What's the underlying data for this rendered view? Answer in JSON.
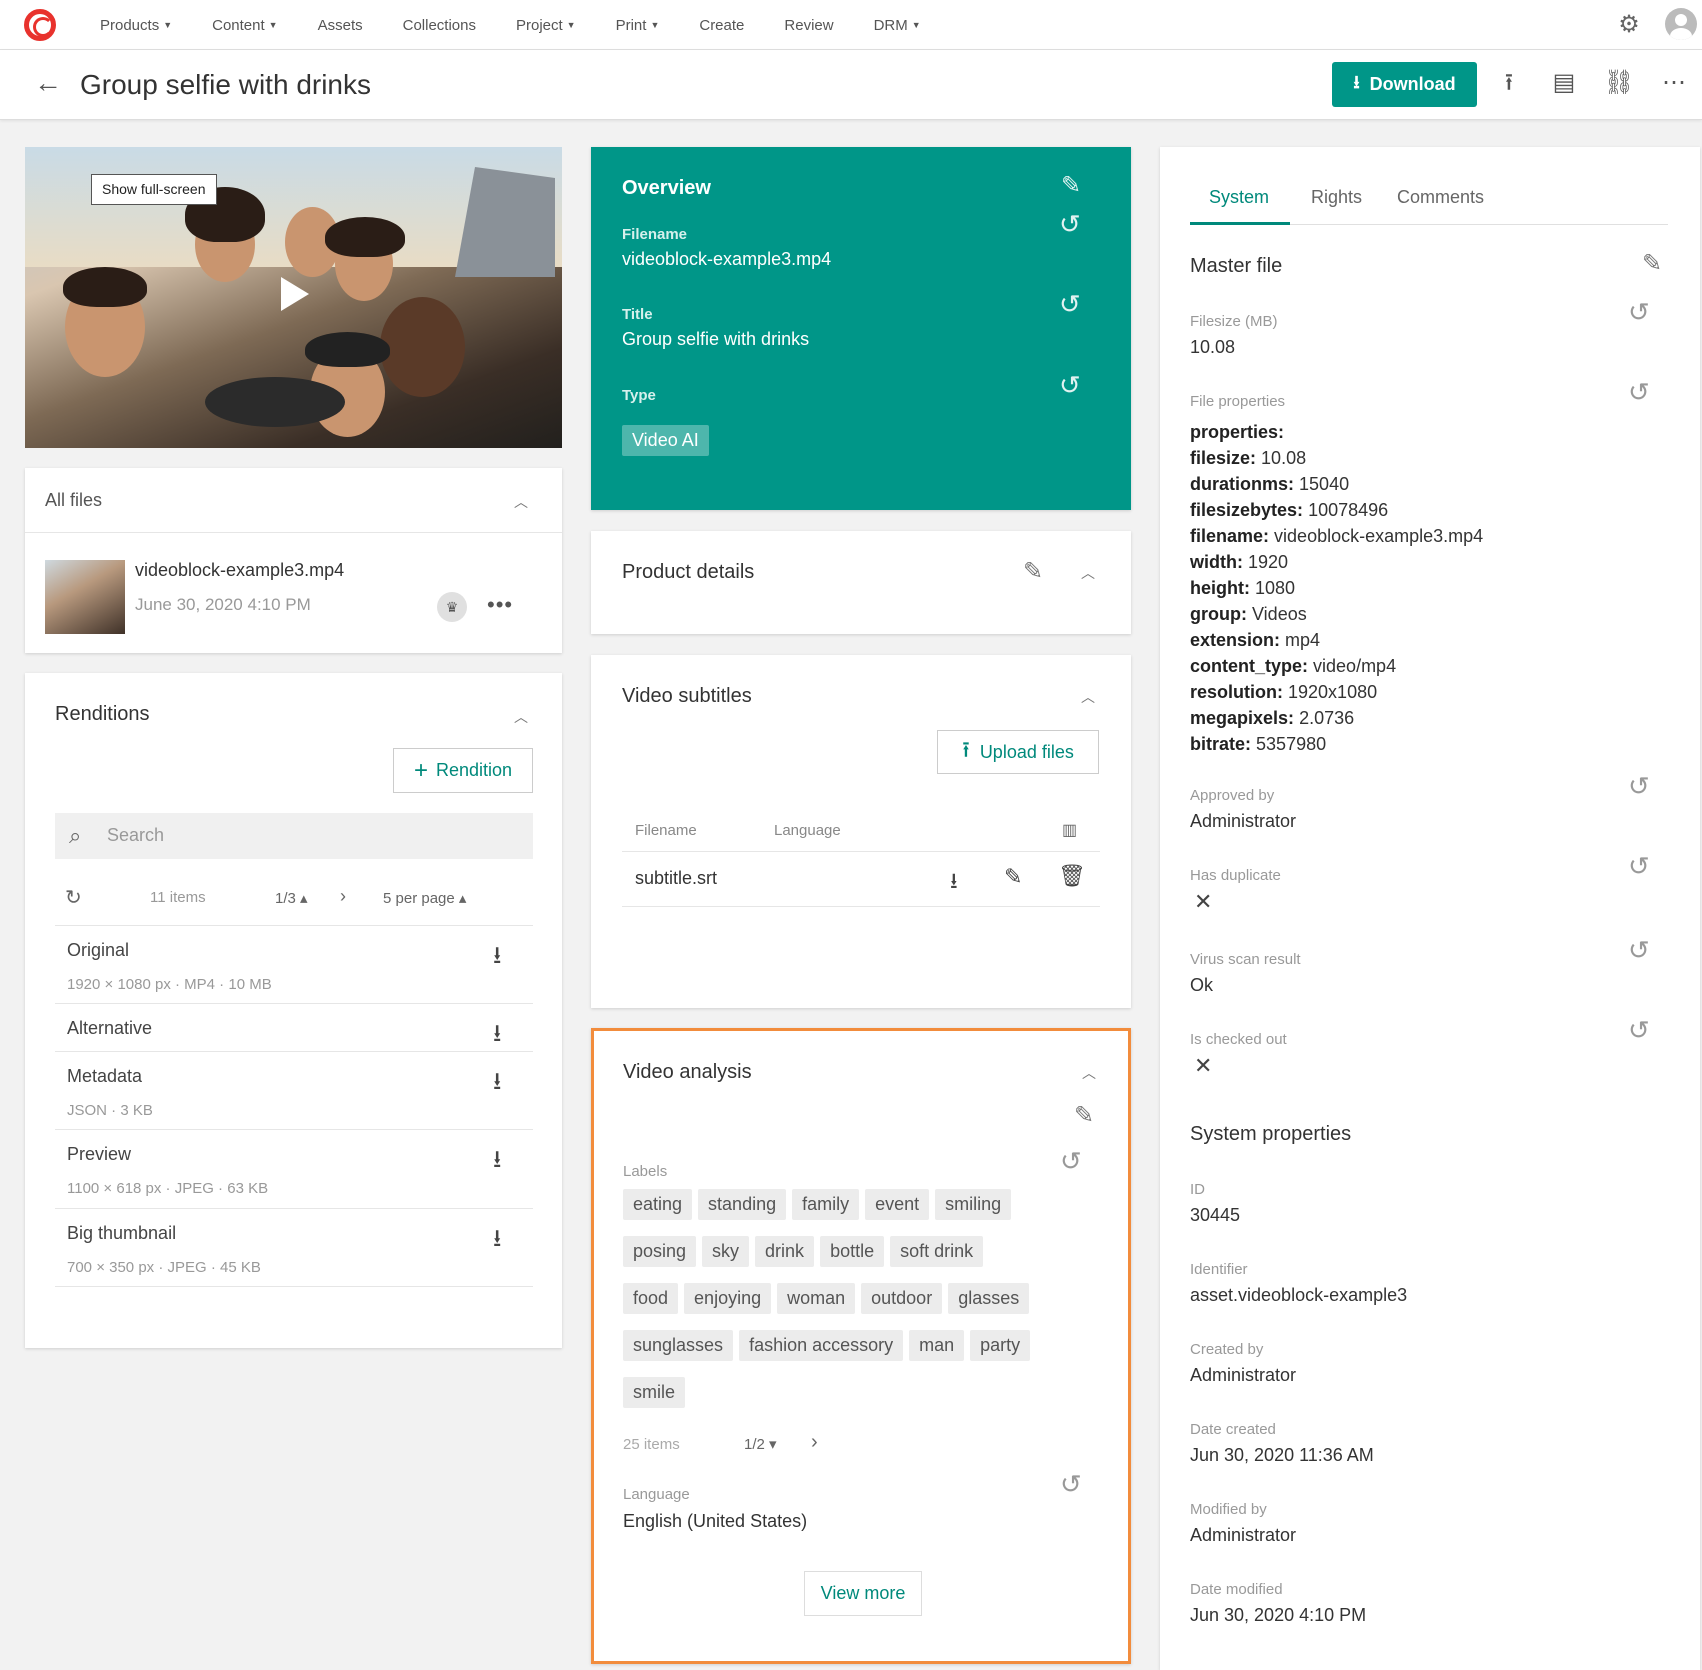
{
  "nav": {
    "items": [
      {
        "label": "Products",
        "caret": true
      },
      {
        "label": "Content",
        "caret": true
      },
      {
        "label": "Assets",
        "caret": false
      },
      {
        "label": "Collections",
        "caret": false
      },
      {
        "label": "Project",
        "caret": true
      },
      {
        "label": "Print",
        "caret": true
      },
      {
        "label": "Create",
        "caret": false
      },
      {
        "label": "Review",
        "caret": false
      },
      {
        "label": "DRM",
        "caret": true
      }
    ]
  },
  "header": {
    "title": "Group selfie with drinks",
    "download_label": "Download"
  },
  "preview": {
    "fullscreen_label": "Show full-screen"
  },
  "all_files": {
    "title": "All files",
    "file": {
      "name": "videoblock-example3.mp4",
      "date": "June 30, 2020 4:10 PM"
    }
  },
  "renditions": {
    "title": "Renditions",
    "add_label": "Rendition",
    "search_placeholder": "Search",
    "count": "11 items",
    "page": "1/3",
    "per_page": "5 per page",
    "rows": [
      {
        "name": "Original",
        "meta": "1920 × 1080 px · MP4 · 10 MB"
      },
      {
        "name": "Alternative",
        "meta": ""
      },
      {
        "name": "Metadata",
        "meta": "JSON · 3 KB"
      },
      {
        "name": "Preview",
        "meta": "1100 × 618 px · JPEG · 63 KB"
      },
      {
        "name": "Big thumbnail",
        "meta": "700 × 350 px · JPEG · 45 KB"
      }
    ]
  },
  "overview": {
    "title": "Overview",
    "filename_label": "Filename",
    "filename": "videoblock-example3.mp4",
    "title_label": "Title",
    "title_value": "Group selfie with drinks",
    "type_label": "Type",
    "type_value": "Video AI"
  },
  "product_details": {
    "title": "Product details"
  },
  "video_subtitles": {
    "title": "Video subtitles",
    "upload_label": "Upload files",
    "col_filename": "Filename",
    "col_language": "Language",
    "rows": [
      {
        "filename": "subtitle.srt"
      }
    ]
  },
  "video_analysis": {
    "title": "Video analysis",
    "labels_label": "Labels",
    "labels": [
      "eating",
      "standing",
      "family",
      "event",
      "smiling",
      "posing",
      "sky",
      "drink",
      "bottle",
      "soft drink",
      "food",
      "enjoying",
      "woman",
      "outdoor",
      "glasses",
      "sunglasses",
      "fashion accessory",
      "man",
      "party",
      "smile"
    ],
    "count": "25 items",
    "page": "1/2",
    "language_label": "Language",
    "language": "English (United States)",
    "view_more_label": "View more"
  },
  "system": {
    "tabs": [
      "System",
      "Rights",
      "Comments"
    ],
    "master_file_title": "Master file",
    "filesize_label": "Filesize (MB)",
    "filesize": "10.08",
    "file_properties_label": "File properties",
    "properties_header": "properties:",
    "properties": [
      {
        "k": "filesize:",
        "v": "10.08"
      },
      {
        "k": "durationms:",
        "v": "15040"
      },
      {
        "k": "filesizebytes:",
        "v": "10078496"
      },
      {
        "k": "filename:",
        "v": "videoblock-example3.mp4"
      },
      {
        "k": "width:",
        "v": "1920"
      },
      {
        "k": "height:",
        "v": "1080"
      },
      {
        "k": "group:",
        "v": "Videos"
      },
      {
        "k": "extension:",
        "v": "mp4"
      },
      {
        "k": "content_type:",
        "v": "video/mp4"
      },
      {
        "k": "resolution:",
        "v": "1920x1080"
      },
      {
        "k": "megapixels:",
        "v": "2.0736"
      },
      {
        "k": "bitrate:",
        "v": "5357980"
      }
    ],
    "approved_by_label": "Approved by",
    "approved_by": "Administrator",
    "has_duplicate_label": "Has duplicate",
    "virus_label": "Virus scan result",
    "virus": "Ok",
    "checked_out_label": "Is checked out",
    "system_properties_title": "System properties",
    "id_label": "ID",
    "id": "30445",
    "identifier_label": "Identifier",
    "identifier": "asset.videoblock-example3",
    "created_by_label": "Created by",
    "created_by": "Administrator",
    "date_created_label": "Date created",
    "date_created": "Jun 30, 2020 11:36 AM",
    "modified_by_label": "Modified by",
    "modified_by": "Administrator",
    "date_modified_label": "Date modified",
    "date_modified": "Jun 30, 2020 4:10 PM"
  },
  "colors": {
    "accent": "#009688",
    "highlight_border": "#f28c3c",
    "logo": "#e8322d"
  }
}
